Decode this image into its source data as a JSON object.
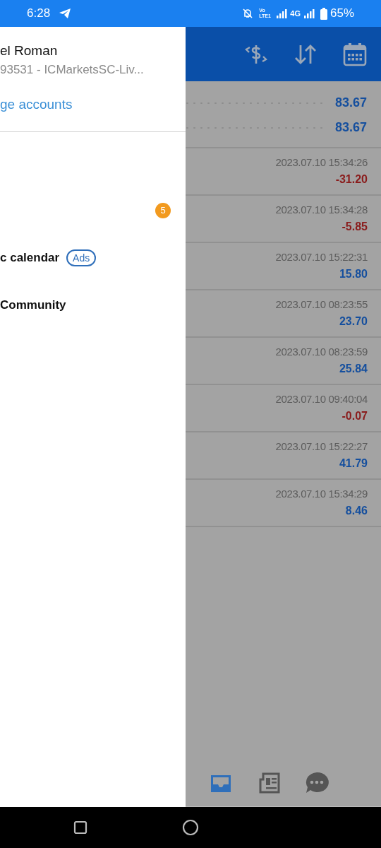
{
  "status_bar": {
    "time": "6:28",
    "volte": "Vo LTE1",
    "network": "4G",
    "battery": "65%"
  },
  "drawer": {
    "account_name": "el Roman",
    "account_detail": "93531 - ICMarketsSC-Liv...",
    "manage_link": "ge accounts",
    "menu": [
      {
        "kind": "badge",
        "badge": "5"
      },
      {
        "kind": "label",
        "label": "c calendar",
        "tag": "Ads"
      },
      {
        "kind": "label",
        "label": "Community"
      }
    ]
  },
  "summary": [
    {
      "value": "83.67"
    },
    {
      "value": "83.67"
    }
  ],
  "deals": [
    {
      "time": "2023.07.10 15:34:26",
      "profit": "-31.20",
      "color": "#8a1c1c"
    },
    {
      "time": "2023.07.10 15:34:28",
      "profit": "-5.85",
      "color": "#8a1c1c"
    },
    {
      "time": "2023.07.10 15:22:31",
      "profit": "15.80",
      "color": "#154f9e"
    },
    {
      "time": "2023.07.10 08:23:55",
      "profit": "23.70",
      "color": "#154f9e"
    },
    {
      "time": "2023.07.10 08:23:59",
      "profit": "25.84",
      "color": "#154f9e"
    },
    {
      "time": "2023.07.10 09:40:04",
      "profit": "-0.07",
      "color": "#8a1c1c"
    },
    {
      "time": "2023.07.10 15:22:27",
      "profit": "41.79",
      "color": "#154f9e"
    },
    {
      "time": "2023.07.10 15:34:29",
      "profit": "8.46",
      "color": "#154f9e"
    }
  ],
  "bottom_tabs": [
    {
      "kind": "inbox",
      "selected": true
    },
    {
      "kind": "news",
      "selected": false
    },
    {
      "kind": "chat",
      "selected": false
    }
  ]
}
